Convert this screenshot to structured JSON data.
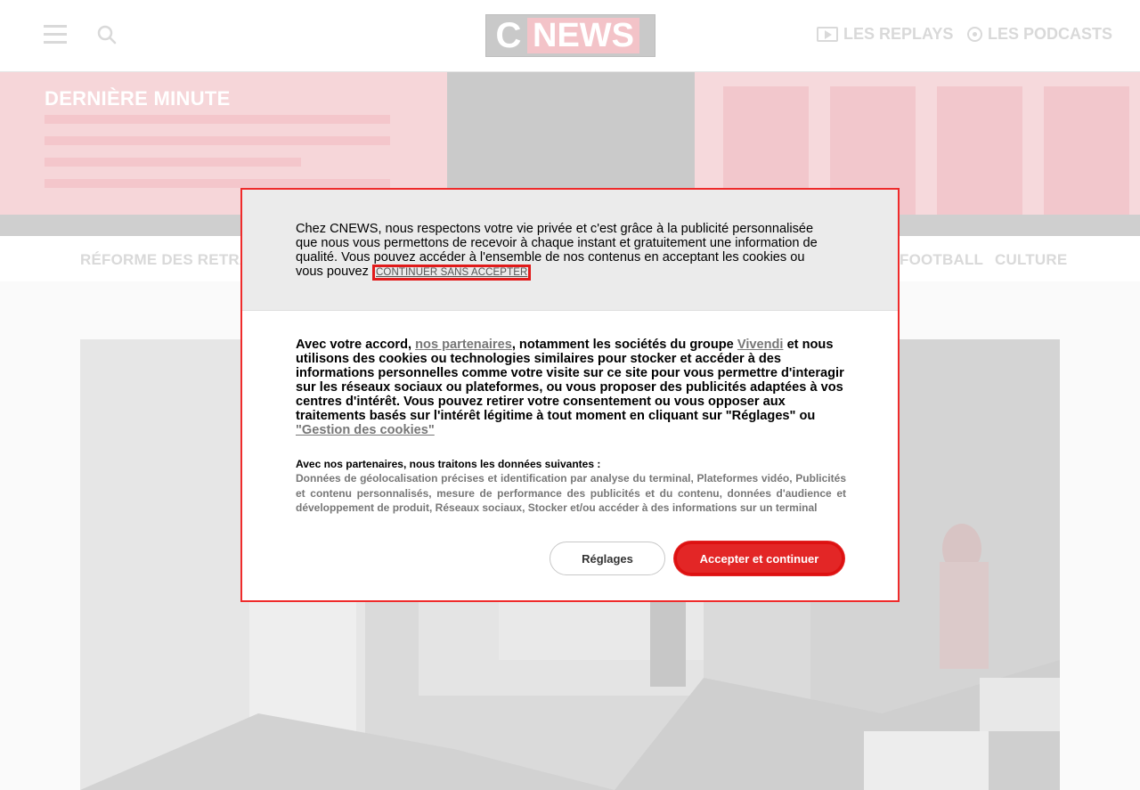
{
  "header": {
    "logo_c": "C",
    "logo_news": "NEWS",
    "replays_label": "LES REPLAYS",
    "podcasts_label": "LES PODCASTS"
  },
  "breaking": {
    "title": "DERNIÈRE MINUTE"
  },
  "categories": {
    "first": "RÉFORME DES RETRAITES",
    "football": "FOOTBALL",
    "culture": "CULTURE"
  },
  "cookie_modal": {
    "intro": "Chez CNEWS, nous respectons votre vie privée et c'est grâce à la publicité personnalisée que nous vous permettons de recevoir à chaque instant et gratuitement une information de qualité. Vous pouvez accéder à l'ensemble de nos contenus en acceptant les cookies ou vous pouvez",
    "continue_without_accepting": "CONTINUER SANS ACCEPTER",
    "consent_prefix": "Avec votre accord,",
    "partners_link": "nos partenaires",
    "consent_mid": ", notamment les sociétés du groupe",
    "vivendi_link": "Vivendi",
    "consent_text": "et nous utilisons des cookies ou technologies similaires pour stocker et accéder à des informations personnelles comme votre visite sur ce site pour vous permettre d'interagir sur les réseaux sociaux ou plateformes, ou vous proposer des publicités adaptées à vos centres d'intérêt. Vous pouvez retirer votre consentement ou vous opposer aux traitements basés sur l'intérêt légitime à tout moment en cliquant sur \"Réglages\" ou",
    "cookie_mgmt_link": "\"Gestion des cookies\"",
    "data_title": "Avec nos partenaires, nous traitons les données suivantes :",
    "data_text": "Données de géolocalisation précises et identification par analyse du terminal, Plateformes vidéo, Publicités et contenu personnalisés, mesure de performance des publicités et du contenu, données d'audience et développement de produit, Réseaux sociaux, Stocker et/ou accéder à des informations sur un terminal",
    "settings_button": "Réglages",
    "accept_button": "Accepter et continuer"
  },
  "colors": {
    "accent": "#e32626",
    "band_pink": "#f6d9dc",
    "modal_border": "#ef2b2b"
  },
  "icons": [
    "hamburger-menu-icon",
    "search-icon",
    "play-icon",
    "podcast-icon"
  ]
}
